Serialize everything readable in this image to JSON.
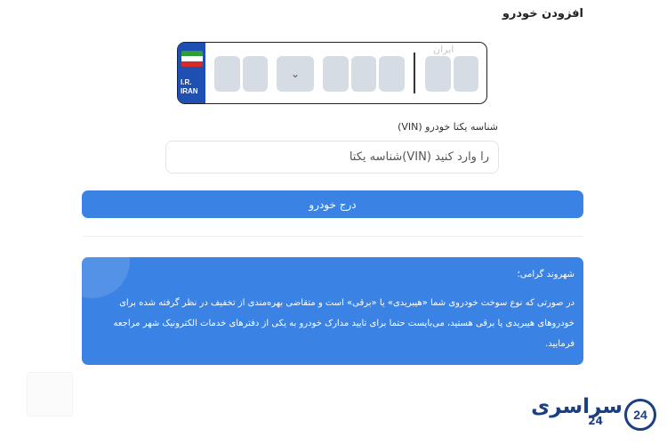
{
  "page": {
    "title": "افزودن خودرو"
  },
  "plate": {
    "country_line1": "I.R.",
    "country_line2": "IRAN",
    "iran_label": "ایران",
    "select_arrow": "⌄",
    "flag_colors": [
      "#2e9e3a",
      "#ffffff",
      "#d62b2b"
    ]
  },
  "vin": {
    "label": "شناسه یکتا خودرو (VIN)",
    "placeholder": "را وارد کنید (VIN)شناسه یکتا",
    "value": ""
  },
  "submit": {
    "label": "درج خودرو"
  },
  "notice": {
    "title": "شهروند گرامی؛",
    "body": "در صورتی که نوع سوخت خودروی شما «هیبریدی» یا «برقی» است و متقاضی بهره‌مندی از تخفیف در نظر گرفته شده برای خودروهای هیبریدی یا برقی هستید، می‌بایست حتما برای تایید مدارک خودرو به یکی از دفترهای خدمات الکترونیک شهر مراجعه فرمایید."
  },
  "logo": {
    "text": "سراسری",
    "sub": "24",
    "badge": "24"
  },
  "colors": {
    "accent": "#3a82e4",
    "plate_blue": "#1f4fb0",
    "logo_navy": "#1c3f82"
  }
}
